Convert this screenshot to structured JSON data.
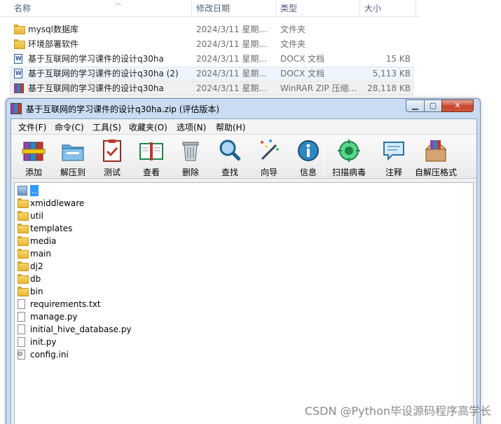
{
  "explorer": {
    "columns": {
      "name": "名称",
      "date": "修改日期",
      "type": "类型",
      "size": "大小"
    },
    "files": [
      {
        "name": "mysql数据库",
        "date": "2024/3/11 星期...",
        "type": "文件夹",
        "size": "",
        "icon": "folder-icon"
      },
      {
        "name": "环境部署软件",
        "date": "2024/3/11 星期...",
        "type": "文件夹",
        "size": "",
        "icon": "folder-icon"
      },
      {
        "name": "基于互联网的学习课件的设计q30ha",
        "date": "2024/3/11 星期...",
        "type": "DOCX 文档",
        "size": "15 KB",
        "icon": "word-doc-icon"
      },
      {
        "name": "基于互联网的学习课件的设计q30ha (2)",
        "date": "2024/3/11 星期...",
        "type": "DOCX 文档",
        "size": "5,113 KB",
        "icon": "word-doc-icon"
      },
      {
        "name": "基于互联网的学习课件的设计q30ha",
        "date": "2024/3/11 星期...",
        "type": "WinRAR ZIP 压缩...",
        "size": "28,118 KB",
        "icon": "winrar-archive-icon"
      }
    ]
  },
  "winrar": {
    "title": "基于互联网的学习课件的设计q30ha.zip (评估版本)",
    "menu": [
      "文件(F)",
      "命令(C)",
      "工具(S)",
      "收藏夹(O)",
      "选项(N)",
      "帮助(H)"
    ],
    "toolbar": [
      {
        "label": "添加",
        "icon": "add-archive-icon"
      },
      {
        "label": "解压到",
        "icon": "extract-to-icon"
      },
      {
        "label": "测试",
        "icon": "test-icon"
      },
      {
        "label": "查看",
        "icon": "view-book-icon"
      },
      {
        "label": "删除",
        "icon": "delete-trash-icon"
      },
      {
        "label": "查找",
        "icon": "find-magnifier-icon"
      },
      {
        "label": "向导",
        "icon": "wizard-wand-icon"
      },
      {
        "label": "信息",
        "icon": "info-icon"
      },
      {
        "label": "扫描病毒",
        "icon": "virus-scan-icon"
      },
      {
        "label": "注释",
        "icon": "comment-icon"
      },
      {
        "label": "自解压格式",
        "icon": "sfx-box-icon"
      }
    ],
    "entries": [
      {
        "name": "..",
        "icon": "parent-dir-icon"
      },
      {
        "name": "xmiddleware",
        "icon": "folder-icon"
      },
      {
        "name": "util",
        "icon": "folder-icon"
      },
      {
        "name": "templates",
        "icon": "folder-icon"
      },
      {
        "name": "media",
        "icon": "folder-icon"
      },
      {
        "name": "main",
        "icon": "folder-icon"
      },
      {
        "name": "dj2",
        "icon": "folder-icon"
      },
      {
        "name": "db",
        "icon": "folder-icon"
      },
      {
        "name": "bin",
        "icon": "folder-icon"
      },
      {
        "name": "requirements.txt",
        "icon": "text-file-icon"
      },
      {
        "name": "manage.py",
        "icon": "text-file-icon"
      },
      {
        "name": "initial_hive_database.py",
        "icon": "text-file-icon"
      },
      {
        "name": "init.py",
        "icon": "text-file-icon"
      },
      {
        "name": "config.ini",
        "icon": "config-file-icon"
      }
    ]
  },
  "watermark": "CSDN @Python毕设源码程序高学长"
}
